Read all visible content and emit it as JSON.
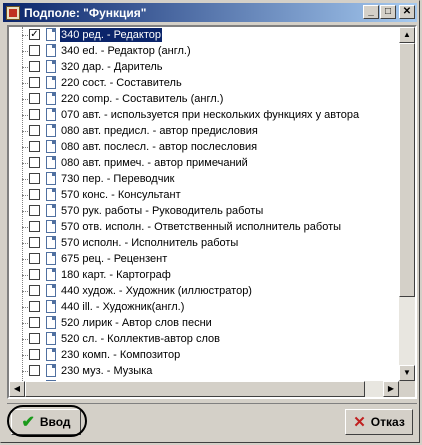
{
  "window": {
    "title": "Подполе: \"Функция\""
  },
  "titlebar_buttons": {
    "minimize": "_",
    "maximize": "□",
    "close": "✕"
  },
  "items": [
    {
      "label": "340 ред. - Редактор",
      "checked": true,
      "selected": true
    },
    {
      "label": "340 ed. - Редактор (англ.)",
      "checked": false,
      "selected": false
    },
    {
      "label": "320 дар. - Даритель",
      "checked": false,
      "selected": false
    },
    {
      "label": "220 сост. - Составитель",
      "checked": false,
      "selected": false
    },
    {
      "label": "220 comp. - Составитель (англ.)",
      "checked": false,
      "selected": false
    },
    {
      "label": "070 авт. - используется при нескольких функциях у автора",
      "checked": false,
      "selected": false
    },
    {
      "label": "080 авт. предисл. - автор предисловия",
      "checked": false,
      "selected": false
    },
    {
      "label": "080 авт. послесл. - автор послесловия",
      "checked": false,
      "selected": false
    },
    {
      "label": "080 авт. примеч. - автор примечаний",
      "checked": false,
      "selected": false
    },
    {
      "label": "730 пер. - Переводчик",
      "checked": false,
      "selected": false
    },
    {
      "label": "570 конс. - Консультант",
      "checked": false,
      "selected": false
    },
    {
      "label": "570 рук. работы - Руководитель работы",
      "checked": false,
      "selected": false
    },
    {
      "label": "570 отв. исполн. - Ответственный исполнитель работы",
      "checked": false,
      "selected": false
    },
    {
      "label": "570 исполн. - Исполнитель работы",
      "checked": false,
      "selected": false
    },
    {
      "label": "675 рец. - Рецензент",
      "checked": false,
      "selected": false
    },
    {
      "label": "180 карт. - Картограф",
      "checked": false,
      "selected": false
    },
    {
      "label": "440 худож. - Художник (иллюстратор)",
      "checked": false,
      "selected": false
    },
    {
      "label": "440 ill. - Художник(англ.)",
      "checked": false,
      "selected": false
    },
    {
      "label": "520 лирик - Автор слов песни",
      "checked": false,
      "selected": false
    },
    {
      "label": "520 сл. - Коллектив-автор слов",
      "checked": false,
      "selected": false
    },
    {
      "label": "230 комп. - Композитор",
      "checked": false,
      "selected": false
    },
    {
      "label": "230 муз. - Музыка",
      "checked": false,
      "selected": false
    },
    {
      "label": "",
      "checked": false,
      "selected": false
    }
  ],
  "scroll_arrows": {
    "up": "▲",
    "down": "▼",
    "left": "◀",
    "right": "▶"
  },
  "buttons": {
    "ok": "Ввод",
    "cancel": "Отказ",
    "ok_icon": "✔",
    "cancel_icon": "✕"
  },
  "colors": {
    "selection": "#0a246a",
    "titlebar_start": "#0a246a",
    "titlebar_end": "#a6caf0",
    "ok_icon": "#1a9a1a",
    "cancel_icon": "#c02020"
  }
}
